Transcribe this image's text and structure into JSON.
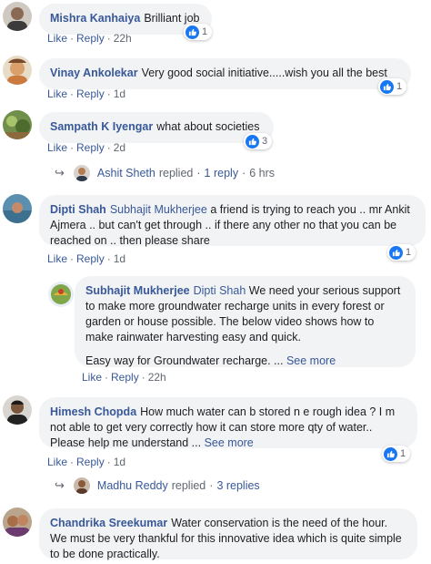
{
  "colors": {
    "accent": "#385898",
    "bubble": "#f2f3f5",
    "like_blue": "#1877f2",
    "meta": "#606770"
  },
  "actions": {
    "like": "Like",
    "reply": "Reply",
    "see_more": "See more"
  },
  "comments": [
    {
      "name": "Mishra Kanhaiya",
      "text": "Brilliant job",
      "time": "22h",
      "reactions": "1"
    },
    {
      "name": "Vinay Ankolekar",
      "text": "Very good social initiative.....wish you all the best",
      "time": "1d",
      "reactions": "1"
    },
    {
      "name": "Sampath K Iyengar",
      "text": "what about societies",
      "time": "2d",
      "reactions": "3",
      "reply_summary": {
        "name": "Ashit Sheth",
        "label": "replied",
        "count": "1 reply",
        "time": "6 hrs"
      }
    },
    {
      "name": "Dipti Shah",
      "tag": "Subhajit Mukherjee",
      "text": "a friend is trying to reach you .. mr Ankit Ajmera .. but can't get through .. if there any other no that you can be reached on .. then please share",
      "time": "1d",
      "reactions": "1"
    },
    {
      "name": "Himesh Chopda",
      "text": "How much water can b stored n e rough idea ? I m not able to get very correctly how it can store more qty of water.. Please help me understand ...",
      "time": "1d",
      "reactions": "1",
      "reply_summary": {
        "name": "Madhu Reddy",
        "label": "replied",
        "count": "3 replies"
      }
    },
    {
      "name": "Chandrika Sreekumar",
      "text": "Water conservation is the need of the hour. We must be very thankful for this innovative idea which is quite simple to be done practically."
    }
  ],
  "nested_reply": {
    "name": "Subhajit Mukherjee",
    "tag": "Dipti Shah",
    "text": "We need your serious support to make more groundwater recharge units in every forest or garden or house possible. The below video shows how to make rainwater harvesting easy and quick.",
    "text2": "Easy way for Groundwater recharge. ...",
    "time": "22h"
  }
}
